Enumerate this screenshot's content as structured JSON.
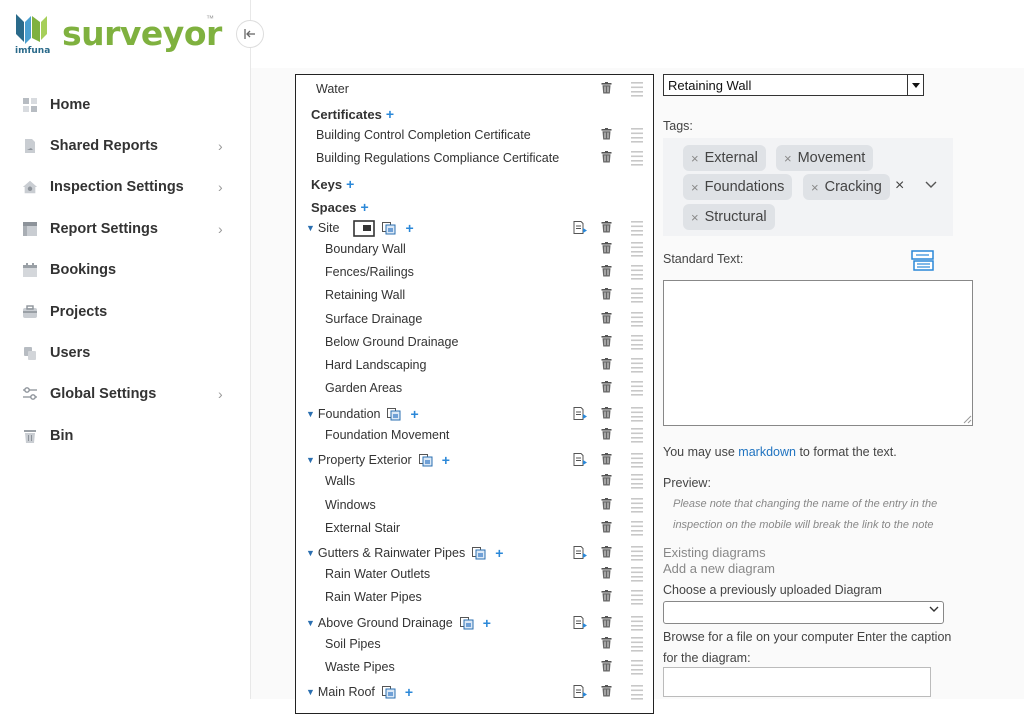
{
  "brand": {
    "name": "surveyor",
    "tm": "™",
    "sub": "imfuna"
  },
  "sidebar": {
    "items": [
      {
        "label": "Home",
        "icon": "home-icon",
        "chevron": false
      },
      {
        "label": "Shared Reports",
        "icon": "shared-reports-icon",
        "chevron": true
      },
      {
        "label": "Inspection Settings",
        "icon": "inspection-settings-icon",
        "chevron": true
      },
      {
        "label": "Report Settings",
        "icon": "report-settings-icon",
        "chevron": true
      },
      {
        "label": "Bookings",
        "icon": "calendar-icon",
        "chevron": false
      },
      {
        "label": "Projects",
        "icon": "briefcase-icon",
        "chevron": false
      },
      {
        "label": "Users",
        "icon": "users-icon",
        "chevron": false
      },
      {
        "label": "Global Settings",
        "icon": "sliders-icon",
        "chevron": true
      },
      {
        "label": "Bin",
        "icon": "bin-icon",
        "chevron": false
      }
    ],
    "chevron_glyph": "›",
    "collapse_glyph": "|←"
  },
  "tree": {
    "rows": [
      {
        "label": "Water",
        "kind": "item",
        "indent": 0
      },
      {
        "label": "Certificates",
        "kind": "section"
      },
      {
        "label": "Building Control Completion Certificate",
        "kind": "item",
        "indent": 0
      },
      {
        "label": "Building Regulations Compliance Certificate",
        "kind": "item",
        "indent": 0
      },
      {
        "label": "Keys",
        "kind": "section"
      },
      {
        "label": "Spaces",
        "kind": "section"
      },
      {
        "label": "Site",
        "kind": "space",
        "image_button": true
      },
      {
        "label": "Boundary Wall",
        "kind": "item",
        "indent": 1
      },
      {
        "label": "Fences/Railings",
        "kind": "item",
        "indent": 1
      },
      {
        "label": "Retaining Wall",
        "kind": "item",
        "indent": 1
      },
      {
        "label": "Surface Drainage",
        "kind": "item",
        "indent": 1
      },
      {
        "label": "Below Ground Drainage",
        "kind": "item",
        "indent": 1
      },
      {
        "label": "Hard Landscaping",
        "kind": "item",
        "indent": 1
      },
      {
        "label": "Garden Areas",
        "kind": "item",
        "indent": 1
      },
      {
        "label": "Foundation",
        "kind": "space"
      },
      {
        "label": "Foundation Movement",
        "kind": "item",
        "indent": 1
      },
      {
        "label": "Property Exterior",
        "kind": "space"
      },
      {
        "label": "Walls",
        "kind": "item",
        "indent": 1
      },
      {
        "label": "Windows",
        "kind": "item",
        "indent": 1
      },
      {
        "label": "External Stair",
        "kind": "item",
        "indent": 1
      },
      {
        "label": "Gutters & Rainwater Pipes",
        "kind": "space"
      },
      {
        "label": "Rain Water Outlets",
        "kind": "item",
        "indent": 1
      },
      {
        "label": "Rain Water Pipes",
        "kind": "item",
        "indent": 1
      },
      {
        "label": "Above Ground Drainage",
        "kind": "space"
      },
      {
        "label": "Soil Pipes",
        "kind": "item",
        "indent": 1
      },
      {
        "label": "Waste Pipes",
        "kind": "item",
        "indent": 1
      },
      {
        "label": "Main Roof",
        "kind": "space"
      }
    ],
    "plus_glyph": "+",
    "caret_glyph": "▼"
  },
  "editor": {
    "name_value": "Retaining Wall",
    "tags_label": "Tags:",
    "tags": [
      "External",
      "Movement",
      "Foundations",
      "Cracking",
      "Structural"
    ],
    "tag_remove_glyph": "×",
    "clear_glyph": "×",
    "tags_chevron_glyph": "⌄",
    "standard_text_label": "Standard Text:",
    "standard_text_value": "",
    "markdown_prefix": "You may use",
    "markdown_link": "markdown",
    "markdown_suffix": "to format the text.",
    "preview_label": "Preview:",
    "preview_note": "Please note that changing the name of the entry in the inspection on the mobile will break the link to the note",
    "existing_diagrams": "Existing diagrams",
    "add_diagram": "Add a new diagram",
    "choose_label": "Choose a previously uploaded Diagram",
    "choose_value": "",
    "browse_label": "Browse for a file on your computer Enter the caption for the diagram:",
    "caption_value": ""
  },
  "colors": {
    "brand_green": "#7fb13f",
    "brand_blue": "#2a6a8a",
    "accent_blue": "#2b88d8",
    "link_blue": "#1f73c0",
    "tag_bg": "#dfe2e6"
  }
}
